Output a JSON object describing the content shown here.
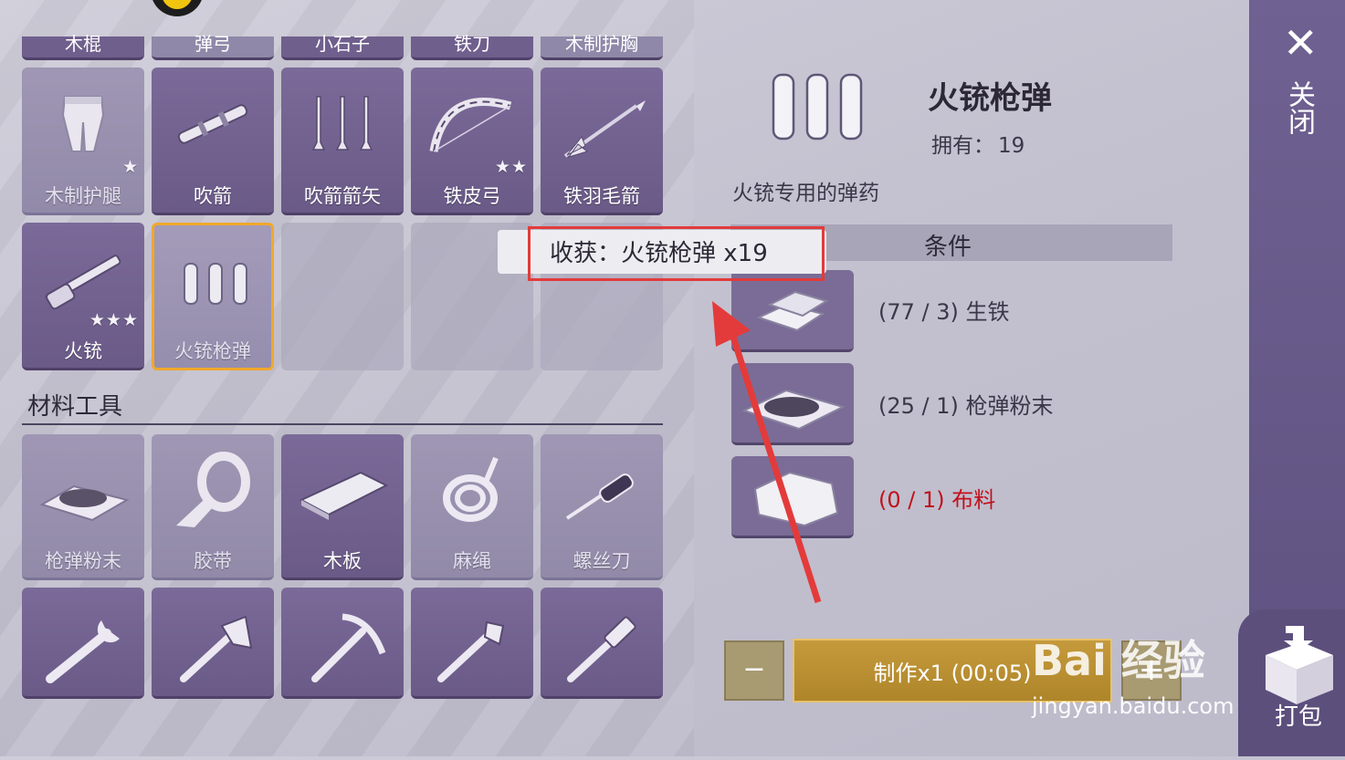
{
  "top_row": [
    "木棍",
    "弹弓",
    "小石子",
    "铁刀",
    "木制护胸"
  ],
  "grid_row1": [
    {
      "label": "木制护腿",
      "stars": "★",
      "faded": true
    },
    {
      "label": "吹箭",
      "stars": "",
      "faded": false
    },
    {
      "label": "吹箭箭矢",
      "stars": "",
      "faded": false
    },
    {
      "label": "铁皮弓",
      "stars": "★★",
      "faded": false
    },
    {
      "label": "铁羽毛箭",
      "stars": "",
      "faded": false
    }
  ],
  "grid_row2": [
    {
      "label": "火铳",
      "stars": "★★★"
    },
    {
      "label": "火铳枪弹",
      "selected": true
    }
  ],
  "section": {
    "title": "材料工具"
  },
  "materials_row": [
    {
      "label": "枪弹粉末",
      "faded": true
    },
    {
      "label": "胶带",
      "faded": true
    },
    {
      "label": "木板",
      "faded": false
    },
    {
      "label": "麻绳",
      "faded": true
    },
    {
      "label": "螺丝刀",
      "faded": true
    }
  ],
  "detail": {
    "title": "火铳枪弹",
    "owned_label": "拥有：",
    "owned_value": "19",
    "description": "火铳专用的弹药",
    "conditions_label": "条件"
  },
  "tooltip": {
    "text": "收获：火铳枪弹 x19"
  },
  "requirements": [
    {
      "text": "(77 / 3) 生铁",
      "missing": false,
      "icon": "iron-ingot-icon"
    },
    {
      "text": "(25 / 1) 枪弹粉末",
      "missing": false,
      "icon": "gunpowder-icon"
    },
    {
      "text": "(0 / 1) 布料",
      "missing": true,
      "icon": "cloth-icon"
    }
  ],
  "buttons": {
    "minus": "−",
    "make": "制作x1 (00:05)",
    "plus": "+",
    "close": "关闭",
    "pack": "打包"
  },
  "watermark": {
    "brand": "Bai  经验",
    "url": "jingyan.baidu.com"
  },
  "colors": {
    "accent": "#f0a82c",
    "missing": "#c1111b",
    "make": "#c59a3c",
    "annotation": "#e33b3b"
  }
}
